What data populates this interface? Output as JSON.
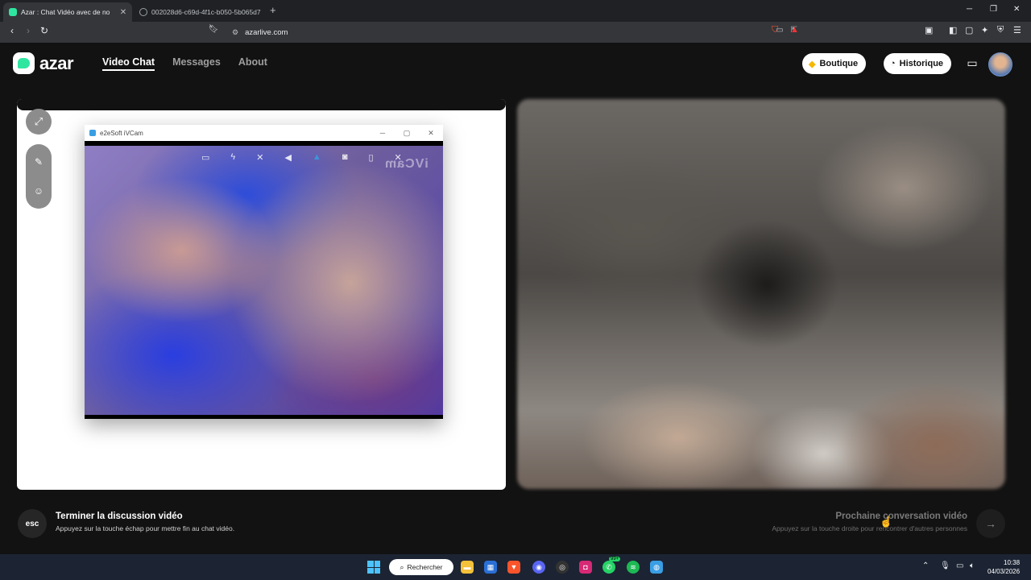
{
  "browser": {
    "tabs": [
      {
        "title": "Azar : Chat Vidéo avec de no",
        "active": true
      },
      {
        "title": "002028d6-c69d-4f1c-b050-5b065d7",
        "active": false
      }
    ],
    "url": "azarlive.com"
  },
  "header": {
    "logo_text": "azar",
    "nav": [
      "Video Chat",
      "Messages",
      "About"
    ],
    "boutique_label": "Boutique",
    "historique_label": "Historique"
  },
  "ivcam": {
    "title": "e2eSoft iVCam",
    "watermark": "iVCam"
  },
  "bottom": {
    "esc_key": "esc",
    "end_title": "Terminer la discussion vidéo",
    "end_hint": "Appuyez sur la touche échap pour mettre fin au chat vidéo.",
    "next_title": "Prochaine conversation vidéo",
    "next_hint": "Appuyez sur la touche droite pour rencontrer d'autres personnes"
  },
  "taskbar": {
    "search_label": "Rechercher",
    "time": "10:38",
    "date": "04/03/2026",
    "badge_whatsapp": "99+"
  },
  "colors": {
    "brand_green": "#2ee6a0",
    "page_bg": "#121212"
  }
}
